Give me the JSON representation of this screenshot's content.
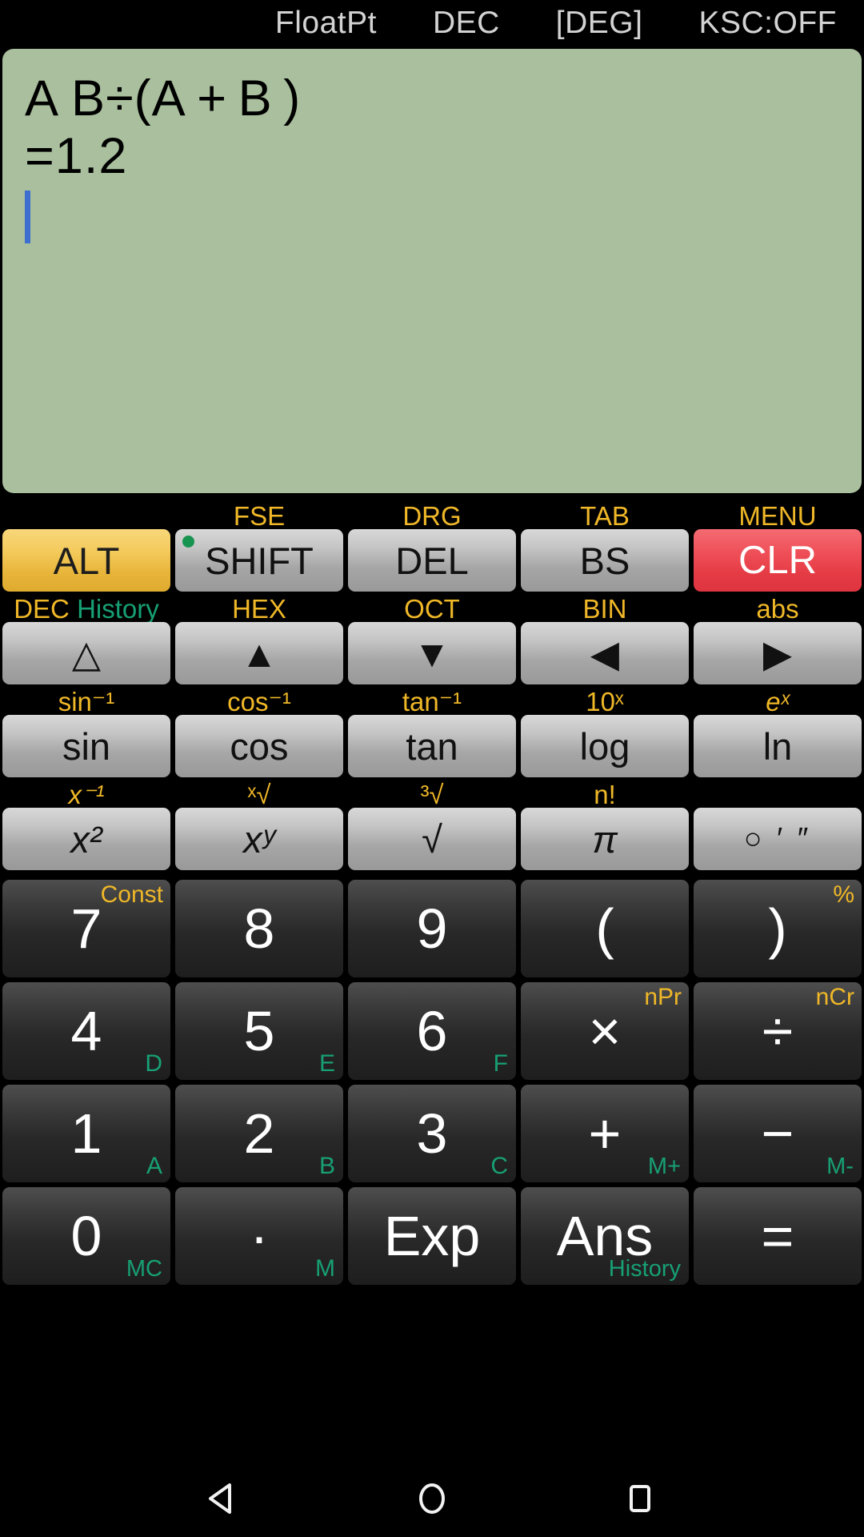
{
  "status": {
    "mode": "FloatPt",
    "base": "DEC",
    "angle": "[DEG]",
    "ksc": "KSC:OFF"
  },
  "display": {
    "expression": "A B÷(A + B )",
    "result": "=1.2",
    "cursor_visible": true,
    "background_color": "#a9bf9d",
    "cursor_color": "#3d6fd0"
  },
  "colors": {
    "alt_key": "#eebb3c",
    "clear_key": "#e8454f",
    "gold_label": "#f0b828",
    "teal_label": "#17a074",
    "shift_indicator": "#17944f"
  },
  "keypad": {
    "rows": [
      {
        "name": "modifier-row",
        "toplabels": [
          "",
          "FSE",
          "DRG",
          "TAB",
          "MENU"
        ],
        "keys": [
          {
            "name": "alt-key",
            "label": "ALT",
            "style": "gold"
          },
          {
            "name": "shift-key",
            "label": "SHIFT",
            "style": "grey",
            "indicator": true
          },
          {
            "name": "delete-key",
            "label": "DEL",
            "style": "grey"
          },
          {
            "name": "backspace-key",
            "label": "BS",
            "style": "grey"
          },
          {
            "name": "clear-key",
            "label": "CLR",
            "style": "red"
          }
        ]
      },
      {
        "name": "arrow-row",
        "toplabels": [
          "DEC",
          "HEX",
          "OCT",
          "BIN",
          "abs"
        ],
        "toplabel_extra": "History",
        "keys": [
          {
            "name": "up-outline-arrow-key",
            "label": "△",
            "style": "grey"
          },
          {
            "name": "up-arrow-key",
            "label": "▲",
            "style": "grey"
          },
          {
            "name": "down-arrow-key",
            "label": "▼",
            "style": "grey"
          },
          {
            "name": "left-arrow-key",
            "label": "◀",
            "style": "grey"
          },
          {
            "name": "right-arrow-key",
            "label": "▶",
            "style": "grey"
          }
        ]
      },
      {
        "name": "trig-row",
        "toplabels": [
          "sin⁻¹",
          "cos⁻¹",
          "tan⁻¹",
          "10ˣ",
          "eˣ"
        ],
        "keys": [
          {
            "name": "sin-key",
            "label": "sin",
            "style": "grey"
          },
          {
            "name": "cos-key",
            "label": "cos",
            "style": "grey"
          },
          {
            "name": "tan-key",
            "label": "tan",
            "style": "grey"
          },
          {
            "name": "log-key",
            "label": "log",
            "style": "grey"
          },
          {
            "name": "ln-key",
            "label": "ln",
            "style": "grey"
          }
        ]
      },
      {
        "name": "power-row",
        "toplabels": [
          "x⁻¹",
          "ˣ√",
          "³√",
          "n!",
          ""
        ],
        "keys": [
          {
            "name": "square-key",
            "label": "x²",
            "style": "grey"
          },
          {
            "name": "power-key",
            "label": "xʸ",
            "style": "grey"
          },
          {
            "name": "square-root-key",
            "label": "√",
            "style": "grey"
          },
          {
            "name": "pi-key",
            "label": "π",
            "style": "grey"
          },
          {
            "name": "degrees-minutes-seconds-key",
            "label": "○ ′ ″",
            "style": "grey"
          }
        ]
      }
    ],
    "numpad": [
      [
        {
          "name": "seven-key",
          "label": "7",
          "alt": "Const",
          "hex": ""
        },
        {
          "name": "eight-key",
          "label": "8",
          "alt": "",
          "hex": ""
        },
        {
          "name": "nine-key",
          "label": "9",
          "alt": "",
          "hex": ""
        },
        {
          "name": "open-paren-key",
          "label": "(",
          "alt": "",
          "hex": ""
        },
        {
          "name": "close-paren-key",
          "label": ")",
          "alt": "%",
          "hex": ""
        }
      ],
      [
        {
          "name": "four-key",
          "label": "4",
          "alt": "",
          "hex": "D"
        },
        {
          "name": "five-key",
          "label": "5",
          "alt": "",
          "hex": "E"
        },
        {
          "name": "six-key",
          "label": "6",
          "alt": "",
          "hex": "F"
        },
        {
          "name": "multiply-key",
          "label": "×",
          "alt": "nPr",
          "hex": ""
        },
        {
          "name": "divide-key",
          "label": "÷",
          "alt": "nCr",
          "hex": ""
        }
      ],
      [
        {
          "name": "one-key",
          "label": "1",
          "alt": "",
          "hex": "A"
        },
        {
          "name": "two-key",
          "label": "2",
          "alt": "",
          "hex": "B"
        },
        {
          "name": "three-key",
          "label": "3",
          "alt": "",
          "hex": "C"
        },
        {
          "name": "plus-key",
          "label": "+",
          "alt": "",
          "hex": "M+"
        },
        {
          "name": "minus-key",
          "label": "−",
          "alt": "",
          "hex": "M-"
        }
      ],
      [
        {
          "name": "zero-key",
          "label": "0",
          "alt": "",
          "hex": "MC"
        },
        {
          "name": "decimal-point-key",
          "label": "·",
          "alt": "",
          "hex": "M"
        },
        {
          "name": "exponent-key",
          "label": "Exp",
          "alt": "",
          "hex": ""
        },
        {
          "name": "answer-key",
          "label": "Ans",
          "alt": "",
          "hex": "History"
        },
        {
          "name": "equals-key",
          "label": "=",
          "alt": "",
          "hex": ""
        }
      ]
    ]
  },
  "navbar": {
    "back": "back-icon",
    "home": "home-icon",
    "recents": "recents-icon"
  }
}
